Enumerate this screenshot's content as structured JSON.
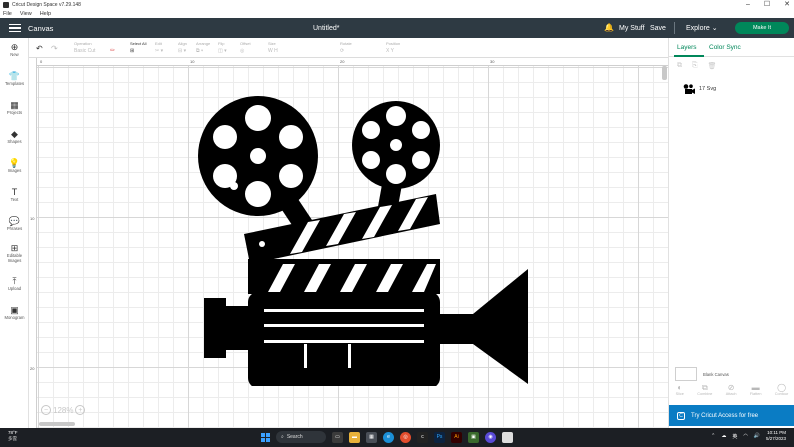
{
  "window": {
    "title": "Cricut Design Space  v7.29.148",
    "controls": [
      "–",
      "☐",
      "✕"
    ]
  },
  "menu": [
    "File",
    "View",
    "Help"
  ],
  "header": {
    "section": "Canvas",
    "doc_title": "Untitled*",
    "my_stuff": "My Stuff",
    "save": "Save",
    "explore": "Explore",
    "make_it": "Make It"
  },
  "toolbar": {
    "groups": [
      {
        "label": "Operation",
        "value": "Basic Cut"
      },
      {
        "label": "Select All",
        "value": "⊞"
      },
      {
        "label": "Edit",
        "value": "✂ ▾"
      },
      {
        "label": "Align",
        "value": "⊟ ▾"
      },
      {
        "label": "Arrange",
        "value": "⧉ ▾"
      },
      {
        "label": "Flip",
        "value": "◫ ▾"
      },
      {
        "label": "Offset",
        "value": "◎"
      },
      {
        "label": "Size",
        "value": "W    H"
      },
      {
        "label": "Rotate",
        "value": "⟳"
      },
      {
        "label": "Position",
        "value": "X    Y"
      }
    ]
  },
  "sidebar": {
    "items": [
      {
        "label": "New",
        "icon": "⊕"
      },
      {
        "label": "Templates",
        "icon": "👕"
      },
      {
        "label": "Projects",
        "icon": "▦"
      },
      {
        "label": "Shapes",
        "icon": "◆"
      },
      {
        "label": "Images",
        "icon": "💡"
      },
      {
        "label": "Text",
        "icon": "T"
      },
      {
        "label": "Phrases",
        "icon": "💬"
      },
      {
        "label": "Editable Images",
        "icon": "⊞"
      },
      {
        "label": "Upload",
        "icon": "⤒"
      },
      {
        "label": "Monogram",
        "icon": "▣"
      }
    ]
  },
  "rulers": {
    "h_ticks": [
      "0",
      "10",
      "20",
      "30"
    ],
    "v_ticks": [
      "10",
      "20"
    ]
  },
  "zoom": {
    "minus": "−",
    "value": "128%",
    "plus": "+"
  },
  "right_panel": {
    "tabs": [
      "Layers",
      "Color Sync"
    ],
    "layer_tools": [
      "⧉",
      "⎘",
      "🗑"
    ],
    "layers": [
      {
        "name": "17 Svg"
      }
    ],
    "blank_canvas": "Blank Canvas",
    "bottom_tools": [
      {
        "label": "Slice",
        "icon": "◐"
      },
      {
        "label": "Combine",
        "icon": "⧉"
      },
      {
        "label": "Attach",
        "icon": "⊘"
      },
      {
        "label": "Flatten",
        "icon": "▬"
      },
      {
        "label": "Contour",
        "icon": "◯"
      }
    ],
    "promo": "Try Cricut Access for free"
  },
  "taskbar": {
    "weather_temp": "78°F",
    "weather_cond": "多雲",
    "search": "Search",
    "time": "10:11 PM",
    "date": "5/27/2023"
  },
  "colors": {
    "topbar": "#2e3a43",
    "accent": "#00875a",
    "promo": "#0a7cc4",
    "art": "#000000"
  }
}
